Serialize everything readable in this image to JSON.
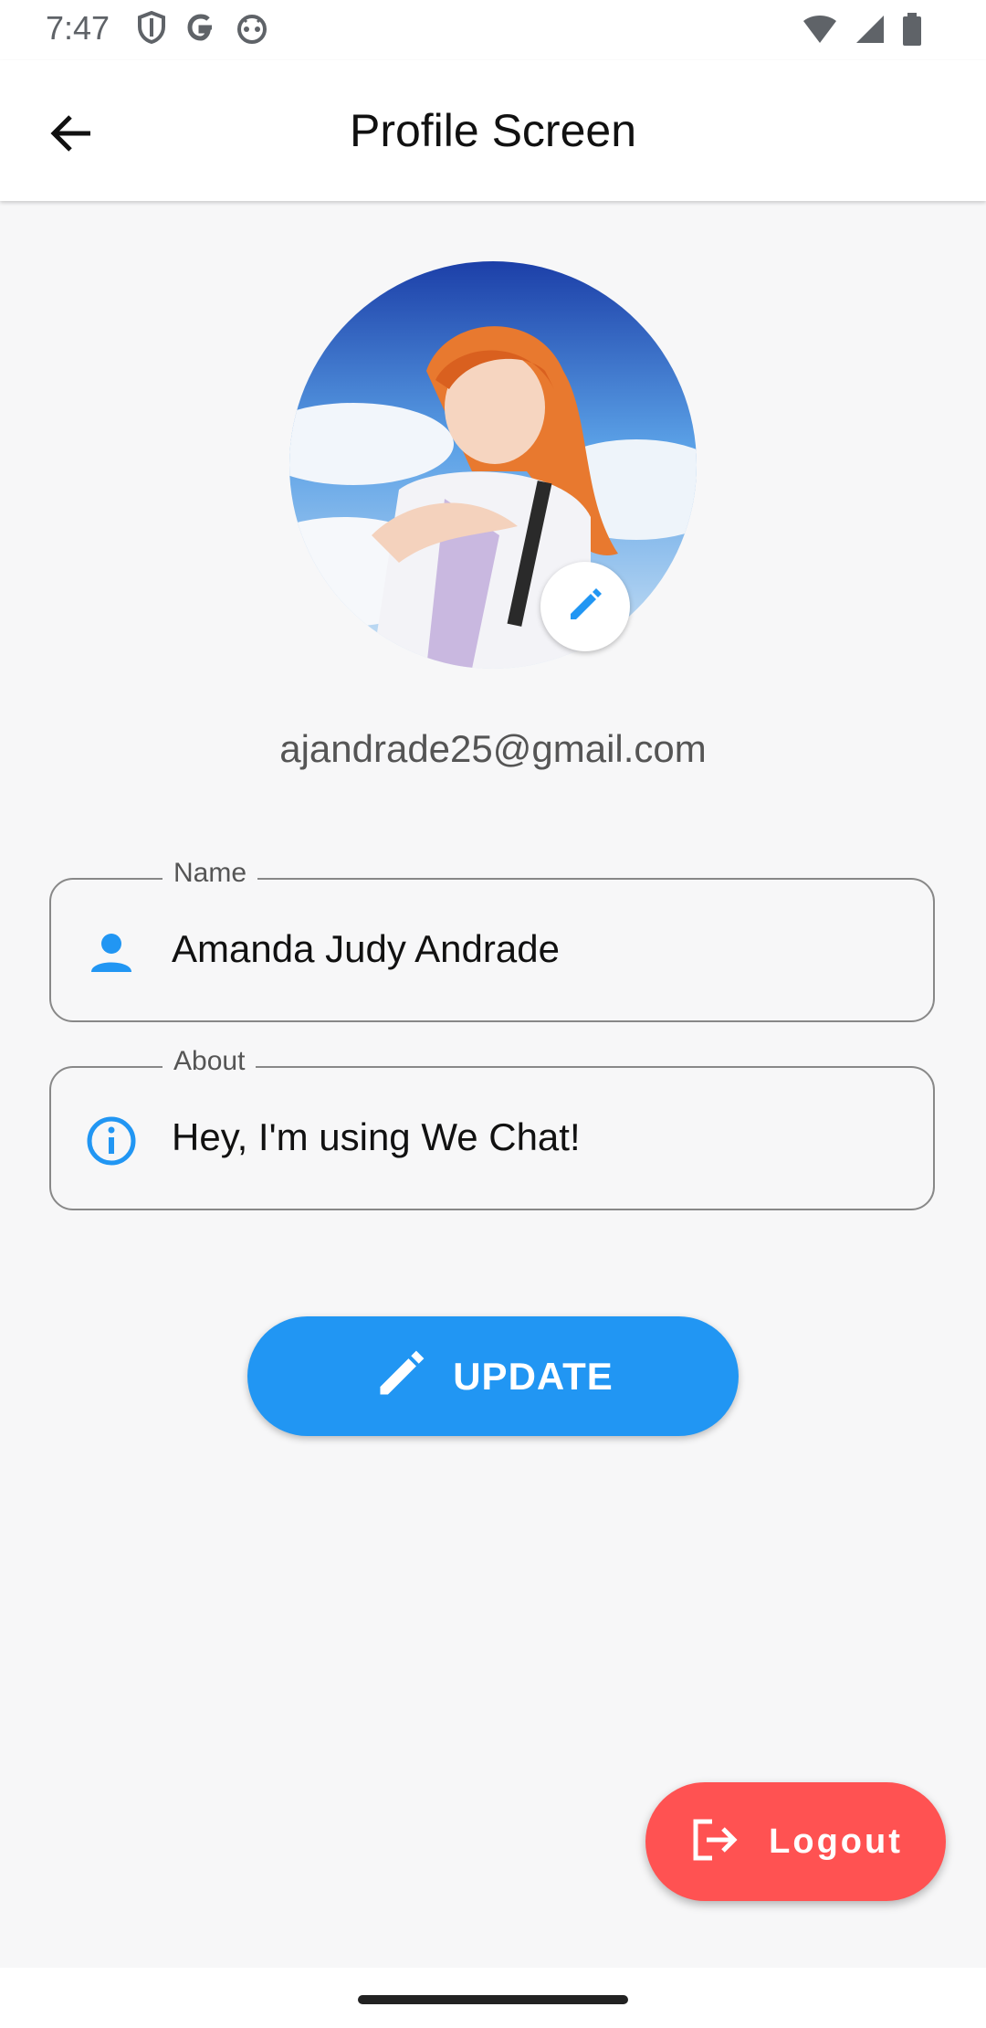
{
  "status_bar": {
    "time": "7:47",
    "left_icons": [
      "shield-icon",
      "google-g-icon",
      "android-face-icon"
    ],
    "right_icons": [
      "wifi-icon",
      "cellular-signal-icon",
      "battery-icon"
    ]
  },
  "app_bar": {
    "title": "Profile Screen",
    "back_icon": "arrow-back-icon"
  },
  "profile": {
    "avatar_icon": "profile-avatar-image",
    "edit_icon": "pencil-icon",
    "email": "ajandrade25@gmail.com"
  },
  "fields": {
    "name": {
      "label": "Name",
      "value": "Amanda Judy Andrade",
      "icon": "person-icon"
    },
    "about": {
      "label": "About",
      "value": "Hey, I'm using We Chat!",
      "icon": "info-icon"
    }
  },
  "update_button": {
    "label": "UPDATE",
    "icon": "pencil-icon"
  },
  "logout_button": {
    "label": "Logout",
    "icon": "logout-icon"
  },
  "colors": {
    "primary": "#2196f3",
    "danger": "#ff5252",
    "background": "#f7f7f8"
  }
}
